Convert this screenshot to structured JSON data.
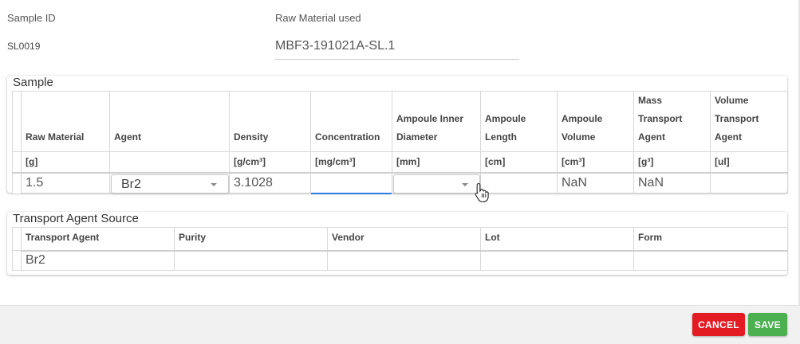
{
  "header": {
    "sample_id_label": "Sample ID",
    "sample_id_value": "SL0019",
    "raw_material_label": "Raw Material used",
    "raw_material_value": "MBF3-191021A-SL.1"
  },
  "sample": {
    "title": "Sample",
    "columns": [
      {
        "label": "Raw Material",
        "unit": "[g]"
      },
      {
        "label": "Agent",
        "unit": ""
      },
      {
        "label": "Density",
        "unit": "[g/cm³]"
      },
      {
        "label": "Concentration",
        "unit": "[mg/cm³]"
      },
      {
        "label": "Ampoule Inner Diameter",
        "unit": "[mm]"
      },
      {
        "label": "Ampoule Length",
        "unit": "[cm]"
      },
      {
        "label": "Ampoule Volume",
        "unit": "[cm³]"
      },
      {
        "label": "Mass Transport Agent",
        "unit": "[g³]"
      },
      {
        "label": "Volume Transport Agent",
        "unit": "[ul]"
      }
    ],
    "row": {
      "raw_material": "1.5",
      "agent": "Br2",
      "density": "3.1028",
      "concentration": "",
      "inner_diameter": "",
      "length": "",
      "volume": "NaN",
      "mass_transport_agent": "NaN",
      "volume_transport_agent": ""
    }
  },
  "transport": {
    "title": "Transport Agent Source",
    "columns": [
      "Transport Agent",
      "Purity",
      "Vendor",
      "Lot",
      "Form"
    ],
    "row": {
      "transport_agent": "Br2",
      "purity": "",
      "vendor": "",
      "lot": "",
      "form": ""
    }
  },
  "footer": {
    "cancel_label": "CANCEL",
    "save_label": "SAVE",
    "cancel_color": "#e31c24",
    "save_color": "#4caf50"
  },
  "icons": {
    "dropdown": "chevron-down-icon",
    "cursor": "hand-pointer-icon"
  }
}
